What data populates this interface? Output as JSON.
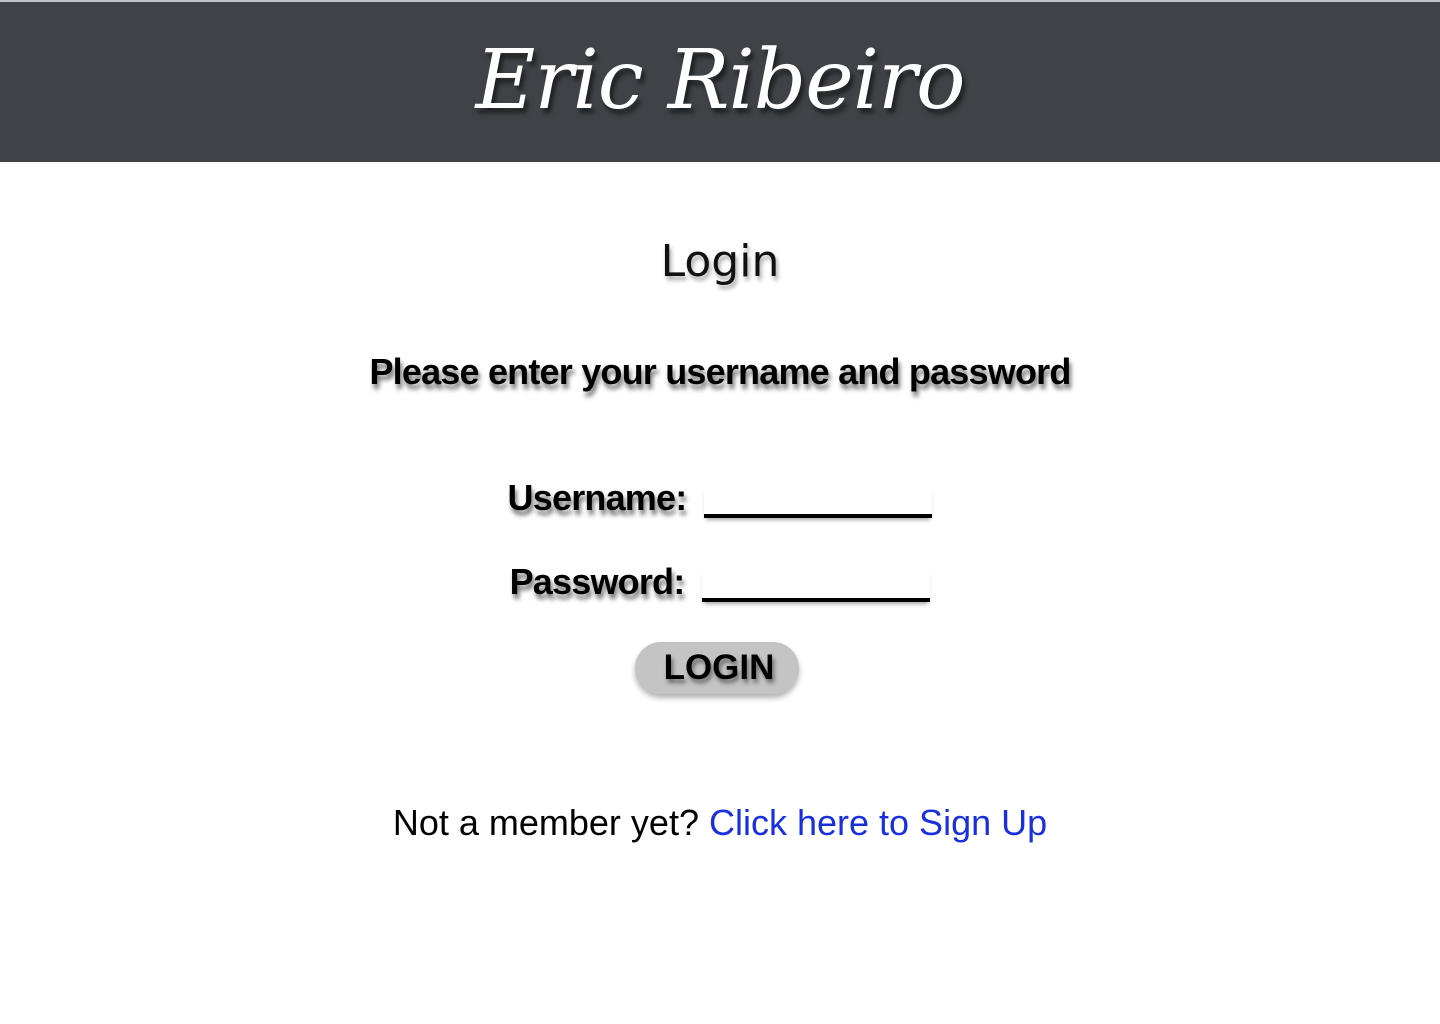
{
  "header": {
    "site_title": "Eric Ribeiro"
  },
  "login": {
    "heading": "Login",
    "instructions": "Please enter your username and password",
    "username_label": "Username:",
    "username_value": "",
    "password_label": "Password:",
    "password_value": "",
    "button_label": "LOGIN"
  },
  "signup": {
    "prompt": "Not a member yet?",
    "link_label": "Click here to Sign Up"
  },
  "colors": {
    "header_bg": "#3f4347",
    "link": "#1a2fe0",
    "button_bg": "#c4c4c4"
  }
}
